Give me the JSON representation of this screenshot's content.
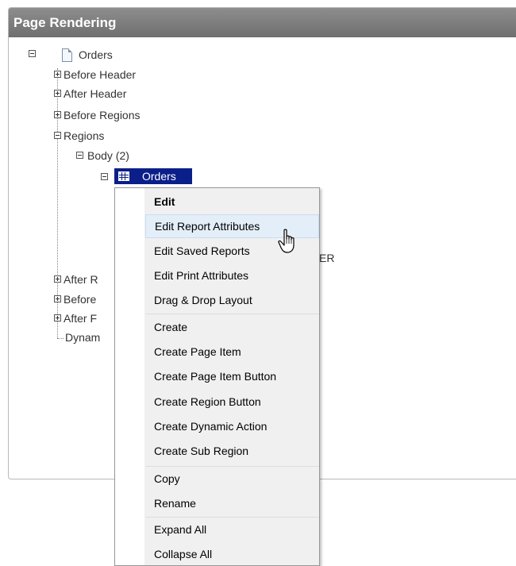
{
  "panel": {
    "title": "Page Rendering"
  },
  "tree": {
    "root": "Orders",
    "before_header": "Before Header",
    "after_header": "After Header",
    "before_regions": "Before Regions",
    "regions": "Regions",
    "body": "Body (2)",
    "region_orders": "Orders",
    "after_regions_partial": "After R",
    "before_partial": "Before",
    "after_f_partial": "After F",
    "dynam_partial": "Dynam",
    "hidden_trailing_text": "ER"
  },
  "context_menu": {
    "items": [
      {
        "label": "Edit"
      },
      {
        "label": "Edit Report Attributes"
      },
      {
        "label": "Edit Saved Reports"
      },
      {
        "label": "Edit Print Attributes"
      },
      {
        "label": "Drag & Drop Layout"
      },
      {
        "label": "Create"
      },
      {
        "label": "Create Page Item"
      },
      {
        "label": "Create Page Item Button"
      },
      {
        "label": "Create Region Button"
      },
      {
        "label": "Create Dynamic Action"
      },
      {
        "label": "Create Sub Region"
      },
      {
        "label": "Copy"
      },
      {
        "label": "Rename"
      },
      {
        "label": "Expand All"
      },
      {
        "label": "Collapse All"
      }
    ],
    "hovered_item": "Edit Report Attributes"
  },
  "colors": {
    "header_bg": "#7a7a7a",
    "selection_bg": "#0a1f8a",
    "menu_hover": "#e3eef9"
  }
}
